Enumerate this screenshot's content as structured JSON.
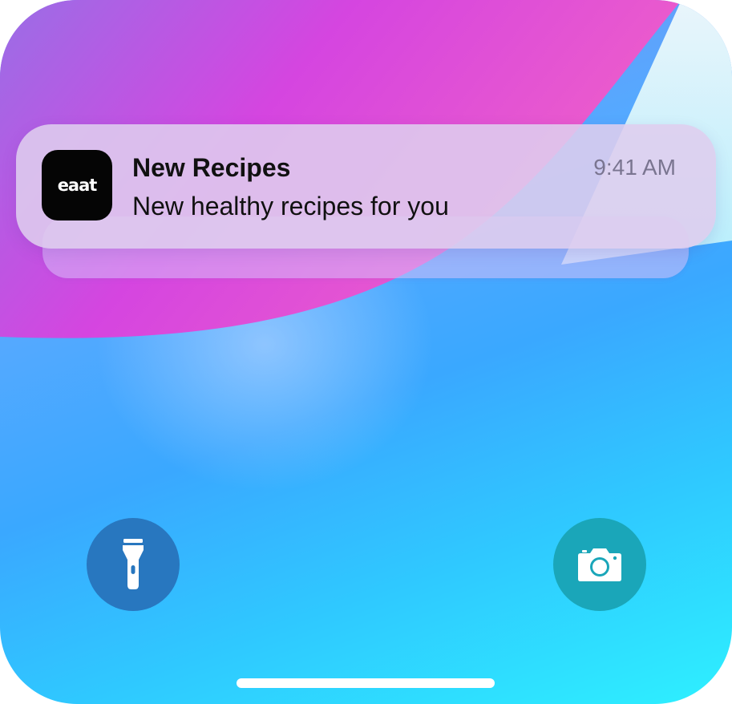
{
  "notification": {
    "app_icon_label": "eaat",
    "title": "New Recipes",
    "body": "New healthy recipes for you",
    "time": "9:41 AM"
  },
  "quick_actions": {
    "left_icon": "flashlight-icon",
    "right_icon": "camera-icon"
  },
  "colors": {
    "wallpaper_magenta": "#d940e0",
    "wallpaper_blue": "#3aa8ff",
    "wallpaper_cyan": "#2ef0ff",
    "flashlight_button": "#2877bf",
    "camera_button": "#1aa6b9",
    "app_icon_bg": "#050505"
  }
}
